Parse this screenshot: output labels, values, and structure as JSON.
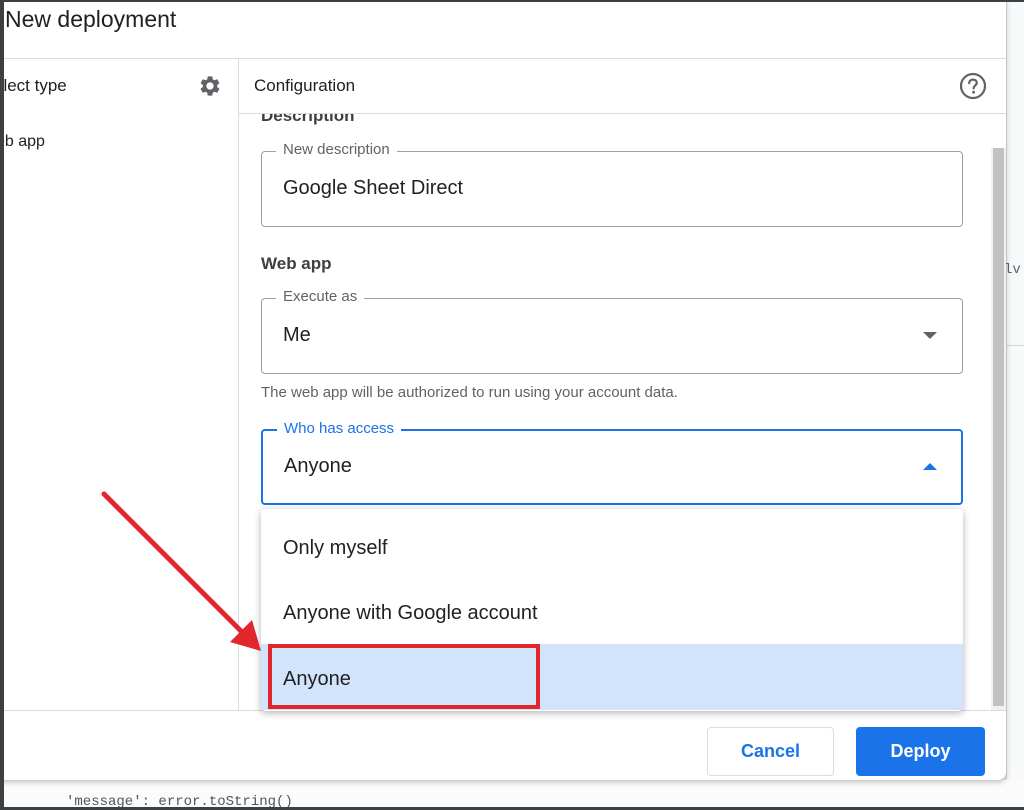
{
  "dialog": {
    "title": "New deployment"
  },
  "left_panel": {
    "heading": "elect type",
    "items": [
      {
        "label": "eb app"
      }
    ],
    "settings_icon": "gear-icon"
  },
  "config": {
    "heading": "Configuration",
    "help_icon": "help-circle-icon",
    "description_section": "Description",
    "description_field": {
      "label": "New description",
      "value": "Google Sheet Direct"
    },
    "webapp_section": "Web app",
    "execute_as": {
      "label": "Execute as",
      "value": "Me"
    },
    "execute_helper": "The web app will be authorized to run using your account data.",
    "who_has_access": {
      "label": "Who has access",
      "value": "Anyone"
    },
    "access_options": [
      {
        "label": "Only myself"
      },
      {
        "label": "Anyone with Google account"
      },
      {
        "label": "Anyone",
        "selected": true
      }
    ]
  },
  "footer": {
    "cancel_label": "Cancel",
    "deploy_label": "Deploy"
  },
  "backdrop": {
    "right_snippet": "lv",
    "bottom_code": "'message': error.toString()"
  },
  "colors": {
    "accent": "#1a73e8",
    "selected_bg": "#d2e3fc",
    "annotation_red": "#e1262c"
  }
}
